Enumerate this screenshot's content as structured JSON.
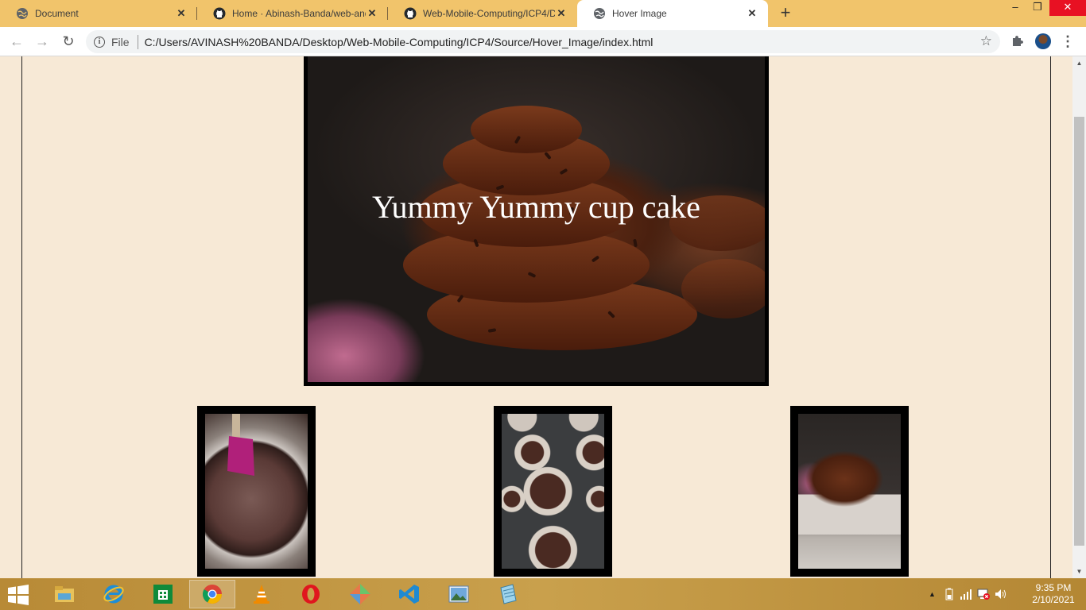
{
  "browser": {
    "tabs": [
      {
        "title": "Document",
        "active": false
      },
      {
        "title": "Home · Abinash-Banda/web-and",
        "active": false
      },
      {
        "title": "Web-Mobile-Computing/ICP4/D",
        "active": false
      },
      {
        "title": "Hover Image",
        "active": true
      }
    ],
    "new_tab_label": "+",
    "window_controls": {
      "minimize": "–",
      "restore": "❐",
      "close": "✕"
    },
    "toolbar": {
      "scheme_label": "File",
      "url": "C:/Users/AVINASH%20BANDA/Desktop/Web-Mobile-Computing/ICP4/Source/Hover_Image/index.html"
    }
  },
  "page": {
    "hero_caption": "Yummy Yummy cup cake",
    "thumbnails": [
      "batter-bowl",
      "cupcake-tin",
      "frosted-cupcake"
    ]
  },
  "taskbar": {
    "apps": [
      "file-explorer",
      "internet-explorer",
      "microsoft-store",
      "chrome",
      "vlc",
      "opera",
      "git-extensions",
      "vscode",
      "photos",
      "notepad"
    ],
    "time": "9:35 PM",
    "date": "2/10/2021"
  },
  "colors": {
    "tab_strip": "#f1c46b",
    "page_background": "#f7e9d6",
    "taskbar": "#c9a04c"
  }
}
